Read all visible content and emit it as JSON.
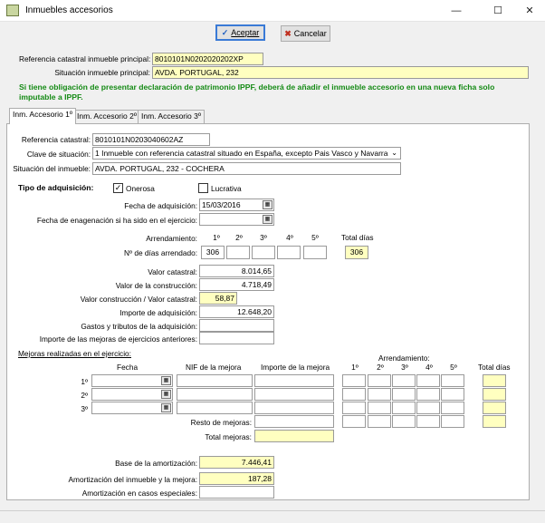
{
  "window": {
    "title": "Inmuebles accesorios"
  },
  "buttons": {
    "accept": "Aceptar",
    "cancel": "Cancelar"
  },
  "header": {
    "ref_label": "Referencia catastral inmueble principal:",
    "ref_value": "8010101N0202020202XP",
    "sit_label": "Situación inmueble principal:",
    "sit_value": "AVDA. PORTUGAL, 232",
    "warning": "Si tiene obligación de presentar declaración de patrimonio IPPF, deberá de añadir el inmueble accesorio en una nueva ficha solo imputable a IPPF."
  },
  "tabs": [
    "Inm. Accesorio 1º",
    "Inm. Accesorio 2º",
    "Inm. Accesorio 3º"
  ],
  "form": {
    "ref_label": "Referencia catastral:",
    "ref_value": "8010101N0203040602AZ",
    "clave_label": "Clave de situación:",
    "clave_value": "1 Inmueble con referencia catastral situado en España, excepto Pais Vasco y Navarra",
    "sit_label": "Situación del inmueble:",
    "sit_value": "AVDA. PORTUGAL, 232 - COCHERA",
    "tipo_label": "Tipo de adquisición:",
    "onerosa": "Onerosa",
    "onerosa_checked": true,
    "lucrativa": "Lucrativa",
    "lucrativa_checked": false,
    "fecha_adq_label": "Fecha de adquisición:",
    "fecha_adq_value": "15/03/2016",
    "fecha_enaj_label": "Fecha de enagenación si ha sido en el ejercicio:",
    "fecha_enaj_value": "",
    "arrend_label": "Arrendamiento:",
    "arrend_cols": [
      "1º",
      "2º",
      "3º",
      "4º",
      "5º"
    ],
    "total_dias_label": "Total días",
    "dias_label": "Nº de días arrendado:",
    "dias_values": [
      "306",
      "",
      "",
      "",
      ""
    ],
    "dias_total": "306",
    "valor_catastral_label": "Valor catastral:",
    "valor_catastral": "8.014,65",
    "valor_construccion_label": "Valor de la construcción:",
    "valor_construccion": "4.718,49",
    "ratio_label": "Valor construcción / Valor catastral:",
    "ratio": "58,87",
    "importe_adq_label": "Importe de adquisición:",
    "importe_adq": "12.648,20",
    "gastos_label": "Gastos y tributos de la adquisición:",
    "gastos": "",
    "mejoras_ant_label": "Importe de las mejoras de ejercicios anteriores:",
    "mejoras_ant": ""
  },
  "mejoras": {
    "title": "Mejoras realizadas en el ejercicio:",
    "col_fecha": "Fecha",
    "col_nif": "NIF de la mejora",
    "col_importe": "Importe de la mejora",
    "arrend_label": "Arrendamiento:",
    "arrend_cols": [
      "1º",
      "2º",
      "3º",
      "4º",
      "5º"
    ],
    "total_dias": "Total días",
    "rows": [
      "1º",
      "2º",
      "3º"
    ],
    "resto_label": "Resto de mejoras:",
    "total_label": "Total mejoras:"
  },
  "amort": {
    "base_label": "Base de la amortización:",
    "base_value": "7.446,41",
    "amort_label": "Amortización del inmueble y la mejora:",
    "amort_value": "187,28",
    "especiales_label": "Amortización en casos especiales:",
    "especiales_value": ""
  },
  "icons": {
    "calendar": "calendar-icon",
    "check": "check-icon",
    "cancel": "cancel-icon"
  },
  "colors": {
    "yellow_field": "#ffffc0",
    "warning_text": "#148a14",
    "default_button": "#3a7ad6"
  }
}
